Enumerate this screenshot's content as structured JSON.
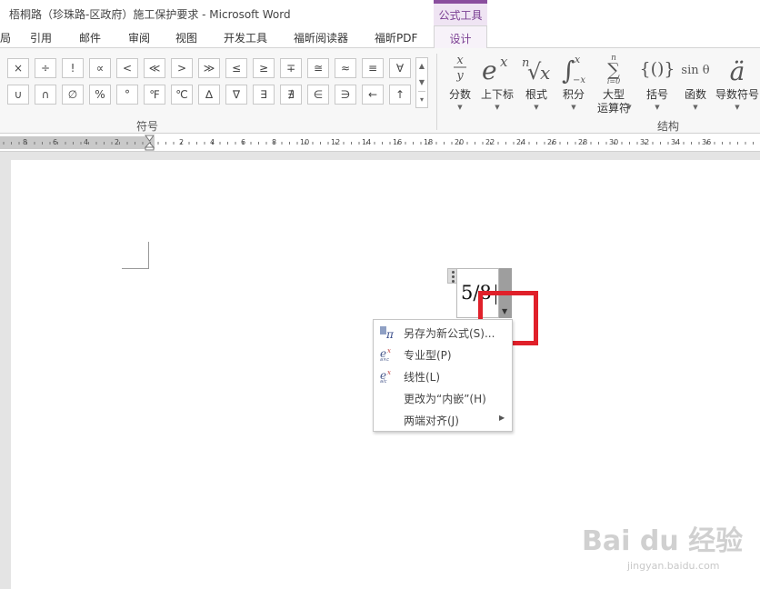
{
  "window": {
    "title": "梧桐路（珍珠路-区政府）施工保护要求 - Microsoft Word"
  },
  "contextual_tab_header": "公式工具",
  "tabs": [
    "局",
    "引用",
    "邮件",
    "审阅",
    "视图",
    "开发工具",
    "福昕阅读器",
    "福昕PDF"
  ],
  "active_tab": "设计",
  "symbols": {
    "group_label": "符号",
    "row1": [
      "×",
      "÷",
      "!",
      "∝",
      "<",
      "≪",
      ">",
      "≫",
      "≤",
      "≥",
      "∓",
      "≅",
      "≈",
      "≡",
      "∀"
    ],
    "row2": [
      "∪",
      "∩",
      "∅",
      "%",
      "°",
      "℉",
      "℃",
      "∆",
      "∇",
      "∃",
      "∄",
      "∈",
      "∋",
      "←",
      "↑"
    ]
  },
  "structures": {
    "group_label": "结构",
    "items": [
      {
        "label": "分数"
      },
      {
        "label": "上下标"
      },
      {
        "label": "根式"
      },
      {
        "label": "积分"
      },
      {
        "label": "大型",
        "label2": "运算符"
      },
      {
        "label": "括号"
      },
      {
        "label": "函数"
      },
      {
        "label": "导数符号"
      }
    ]
  },
  "ruler": {
    "left_labels": [
      "8",
      "6",
      "4",
      "2"
    ],
    "main_labels": [
      "2",
      "4",
      "6",
      "8",
      "10",
      "12",
      "14",
      "16",
      "18",
      "20",
      "22",
      "24",
      "26",
      "28",
      "30",
      "32",
      "34",
      "36"
    ]
  },
  "equation": {
    "text": "5/8"
  },
  "context_menu": {
    "items": [
      {
        "label": "另存为新公式(S)...",
        "icon": "pi-icon"
      },
      {
        "label": "专业型(P)",
        "icon": "professional-format-icon"
      },
      {
        "label": "线性(L)",
        "icon": "linear-format-icon"
      },
      {
        "label": "更改为“内嵌”(H)"
      },
      {
        "label": "两端对齐(J)",
        "submenu": true
      }
    ]
  },
  "watermark": {
    "logo": "Bai du 经验",
    "url": "jingyan.baidu.com"
  },
  "colors": {
    "accent": "#8a4e9e",
    "highlight": "#e0202a"
  }
}
